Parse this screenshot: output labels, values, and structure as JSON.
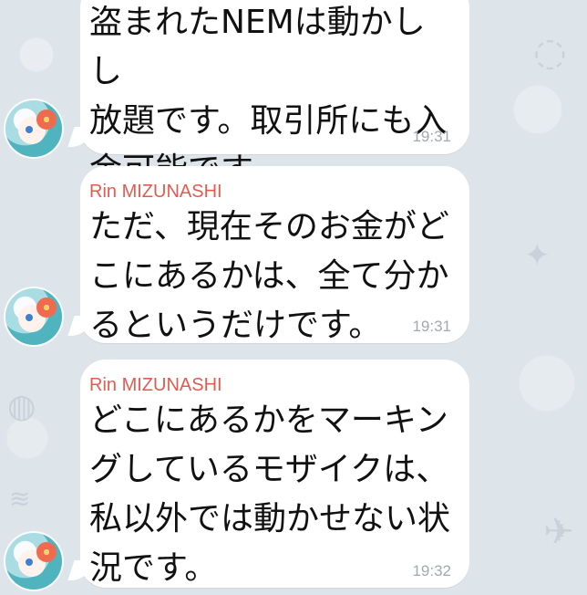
{
  "conversation": {
    "messages": [
      {
        "text": "盗まれたNEMは動かしし\n放題です。取引所にも入\n金可能です。",
        "time": "19:31"
      },
      {
        "sender": "Rin MIZUNASHI",
        "text": "ただ、現在そのお金がど\nこにあるかは、全て分か\nるというだけです。",
        "time": "19:31"
      },
      {
        "sender": "Rin MIZUNASHI",
        "text": "どこにあるかをマーキン\nグしているモザイクは、\n私以外では動かせない状\n況です。",
        "time": "19:32"
      }
    ]
  }
}
